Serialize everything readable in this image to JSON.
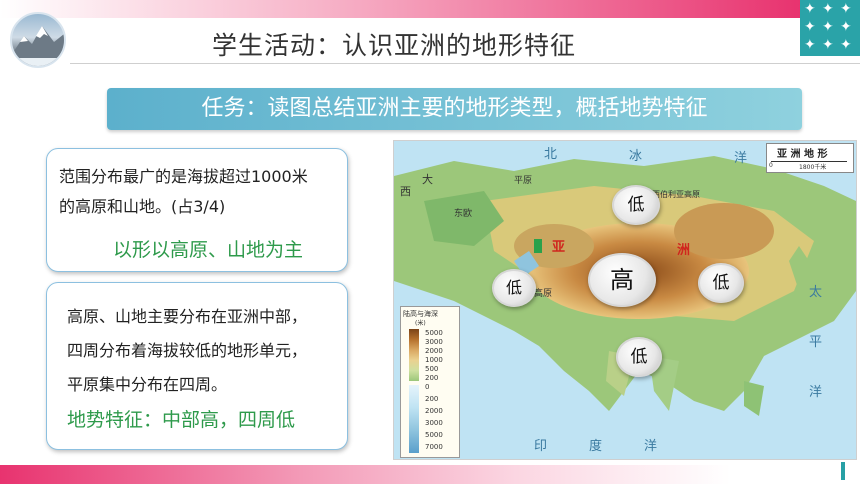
{
  "header": {
    "title": "学生活动：认识亚洲的地形特征"
  },
  "task": {
    "text": "任务：读图总结亚洲主要的地形类型，概括地势特征"
  },
  "box1": {
    "line1": "范围分布最广的是海拔超过1000米",
    "line2": "的高原和山地。(占3/4)",
    "highlight": "以形以高原、山地为主"
  },
  "box2": {
    "line1": "高原、山地主要分布在亚洲中部，",
    "line2": "四周分布着海拔较低的地形单元，",
    "line3": "平原集中分布在四周。",
    "highlight": "地势特征：中部高，四周低"
  },
  "map": {
    "title": "亚 洲 地 形",
    "scale_zero": "0",
    "scale_value": "1800千米",
    "bubbles": {
      "north": "低",
      "center": "高",
      "west": "低",
      "east": "低",
      "south": "低"
    },
    "labels": {
      "north_ocean": "北",
      "ice_ocean": "冰",
      "ocean1": "洋",
      "west_word": "西",
      "large": "大",
      "asia_red": "亚",
      "zhou_red": "洲",
      "pacific_tai": "太",
      "pacific_ping": "平",
      "pacific_yang": "洋",
      "indian_yin": "印",
      "indian_du": "度",
      "indian_yang": "洋",
      "plateau_west": "高原",
      "plain": "平原",
      "siberia": "中西伯利亚高原",
      "east_euro": "东欧"
    },
    "legend": {
      "title": "陆高与海深",
      "unit": "(米)",
      "levels": [
        "5000",
        "3000",
        "2000",
        "1000",
        "500",
        "200",
        "0",
        "200",
        "2000",
        "3000",
        "5000",
        "7000"
      ]
    }
  }
}
